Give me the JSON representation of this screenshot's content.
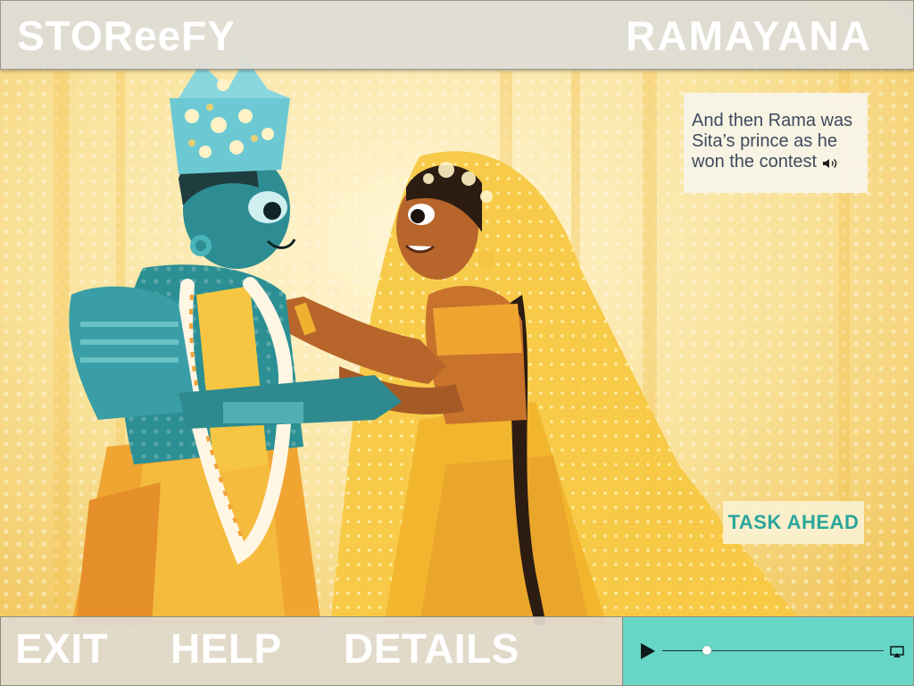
{
  "header": {
    "brand": "STOReeFY",
    "book_title": "RAMAYANA"
  },
  "illustration": {
    "icon": "rama-sita-wedding-illustration"
  },
  "narration": {
    "text": "And then Rama was Sita’s prince as he won the contest",
    "speaker_icon": "speaker-icon"
  },
  "task": {
    "label": "TASK AHEAD"
  },
  "footer": {
    "exit_label": "EXIT",
    "help_label": "HELP",
    "details_label": "DETAILS"
  },
  "player": {
    "progress": 0.2,
    "play_icon": "play-icon",
    "airplay_icon": "airplay-icon"
  },
  "colors": {
    "header_bar": "#dedcd6",
    "player_bg": "#66d6c6",
    "task_text": "#2aa69b",
    "narration_text": "#3e4a5e",
    "scene_yellow": "#f6d77a"
  }
}
